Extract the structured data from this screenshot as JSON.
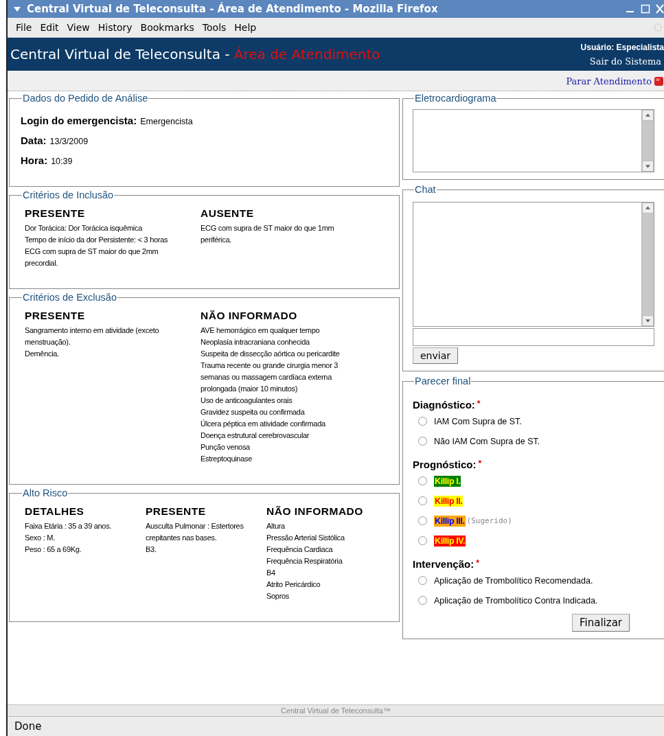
{
  "window": {
    "title": "Central Virtual de Teleconsulta - Área de Atendimento - Mozilla Firefox"
  },
  "menu": [
    "File",
    "Edit",
    "View",
    "History",
    "Bookmarks",
    "Tools",
    "Help"
  ],
  "header": {
    "title": "Central Virtual de Teleconsulta - ",
    "area": "Área de Atendimento",
    "user": "Usuário: Especialista",
    "logout": "Sair do Sistema",
    "stop": "Parar Atendimento"
  },
  "pedido": {
    "legend": "Dados do Pedido de Análise",
    "fields": [
      {
        "label": "Login do emergencista:",
        "value": "Emergencista"
      },
      {
        "label": "Data:",
        "value": "13/3/2009"
      },
      {
        "label": "Hora:",
        "value": "10:39"
      }
    ]
  },
  "sections": [
    {
      "legend": "Critérios de Inclusão",
      "columns": [
        {
          "heading": "PRESENTE",
          "items": [
            "Dor Torácica: Dor Torácica isquêmica",
            "Tempo de início da dor Persistente: < 3 horas",
            "ECG com supra de ST maior do que 2mm precordial."
          ]
        },
        {
          "heading": "AUSENTE",
          "items": [
            "ECG com supra de ST maior do que 1mm periférica."
          ]
        }
      ]
    },
    {
      "legend": "Critérios de Exclusão",
      "columns": [
        {
          "heading": "PRESENTE",
          "items": [
            "Sangramento interno em atividade (exceto menstruação).",
            "Demência."
          ]
        },
        {
          "heading": "NÃO INFORMADO",
          "items": [
            "AVE hemorrágico em qualquer tempo",
            "Neoplasia intracraniana conhecida",
            "Suspeita de dissecção aórtica ou pericardite",
            "Trauma recente ou grande cirurgia menor 3 semanas ou massagem cardíaca externa prolongada (maior 10 minutos)",
            "Uso de anticoagulantes orais",
            "Gravidez suspeita ou confirmada",
            "Úlcera péptica em atividade confirmada",
            "Doença estrutural cerebrovascular",
            "Punção venosa",
            "Estreptoquinase"
          ]
        }
      ]
    },
    {
      "legend": "Alto Risco",
      "columns": [
        {
          "heading": "DETALHES",
          "items": [
            "Faixa Etária : 35 a 39 anos.",
            "Sexo : M.",
            "Peso : 65 a 69Kg."
          ]
        },
        {
          "heading": "PRESENTE",
          "items": [
            "Ausculta Pulmonar : Estertores crepitantes nas bases.",
            "B3."
          ]
        },
        {
          "heading": "NÃO INFORMADO",
          "items": [
            "Altura",
            "Pressão Arterial Sistólica",
            "Frequência Cardiaca",
            "Frequência Respiratória",
            "B4",
            "Atrito Pericárdico",
            "Sopros"
          ]
        }
      ]
    }
  ],
  "ecg": {
    "legend": "Eletrocardiograma"
  },
  "chat": {
    "legend": "Chat",
    "send": "enviar"
  },
  "parecer": {
    "legend": "Parecer final",
    "groups": [
      {
        "label": "Diagnóstico:",
        "required": "*",
        "options": [
          {
            "label": "IAM Com Supra de ST.",
            "selected": false
          },
          {
            "label": "Não IAM Com Supra de ST.",
            "selected": false
          }
        ]
      },
      {
        "label": "Prognóstico:",
        "required": "*",
        "options": [
          {
            "label": "Killip I.",
            "selected": false,
            "color": "#008000"
          },
          {
            "label": "Killip II.",
            "selected": false,
            "color": "#ffff00"
          },
          {
            "label": "Killip III.",
            "selected": false,
            "color": "#ffa500",
            "note": "(Sugerido)"
          },
          {
            "label": "Killip IV.",
            "selected": false,
            "color": "#ff0000"
          }
        ]
      },
      {
        "label": "Intervenção:",
        "required": "*",
        "options": [
          {
            "label": "Aplicação de Trombolítico Recomendada.",
            "selected": false
          },
          {
            "label": "Aplicação de Trombolítico Contra Indicada.",
            "selected": false
          }
        ]
      }
    ],
    "submit": "Finalizar"
  },
  "footer": "Central Virtual de Teleconsulta™",
  "status_bar": "Done"
}
